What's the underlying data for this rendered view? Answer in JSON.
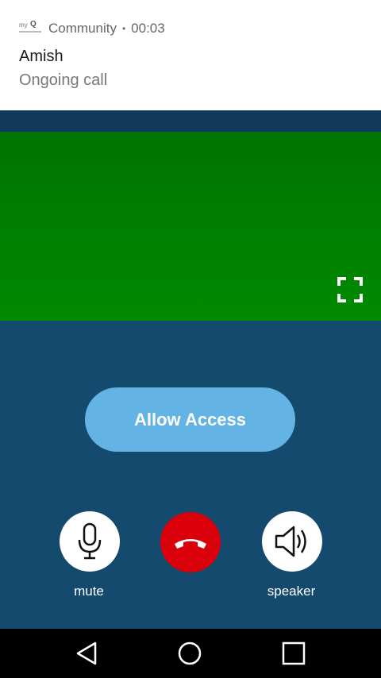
{
  "notification": {
    "app_logo": "myQ Community logo",
    "app_name": "Community",
    "separator": "•",
    "elapsed": "00:03",
    "title": "Amish",
    "text": "Ongoing call"
  },
  "video": {
    "fullscreen_icon": "fullscreen-icon",
    "background_color": "#008000"
  },
  "actions": {
    "allow_access": "Allow Access"
  },
  "controls": {
    "mute": {
      "label": "mute",
      "icon": "microphone-icon"
    },
    "hangup": {
      "icon": "phone-hangup-icon",
      "color": "#d9000b"
    },
    "speaker": {
      "label": "speaker",
      "icon": "speaker-icon"
    }
  },
  "navbar": {
    "back_icon": "back-triangle-icon",
    "home_icon": "home-circle-icon",
    "recents_icon": "recents-square-icon"
  },
  "colors": {
    "background": "#134a6e",
    "allow_button": "#63b3e4"
  }
}
